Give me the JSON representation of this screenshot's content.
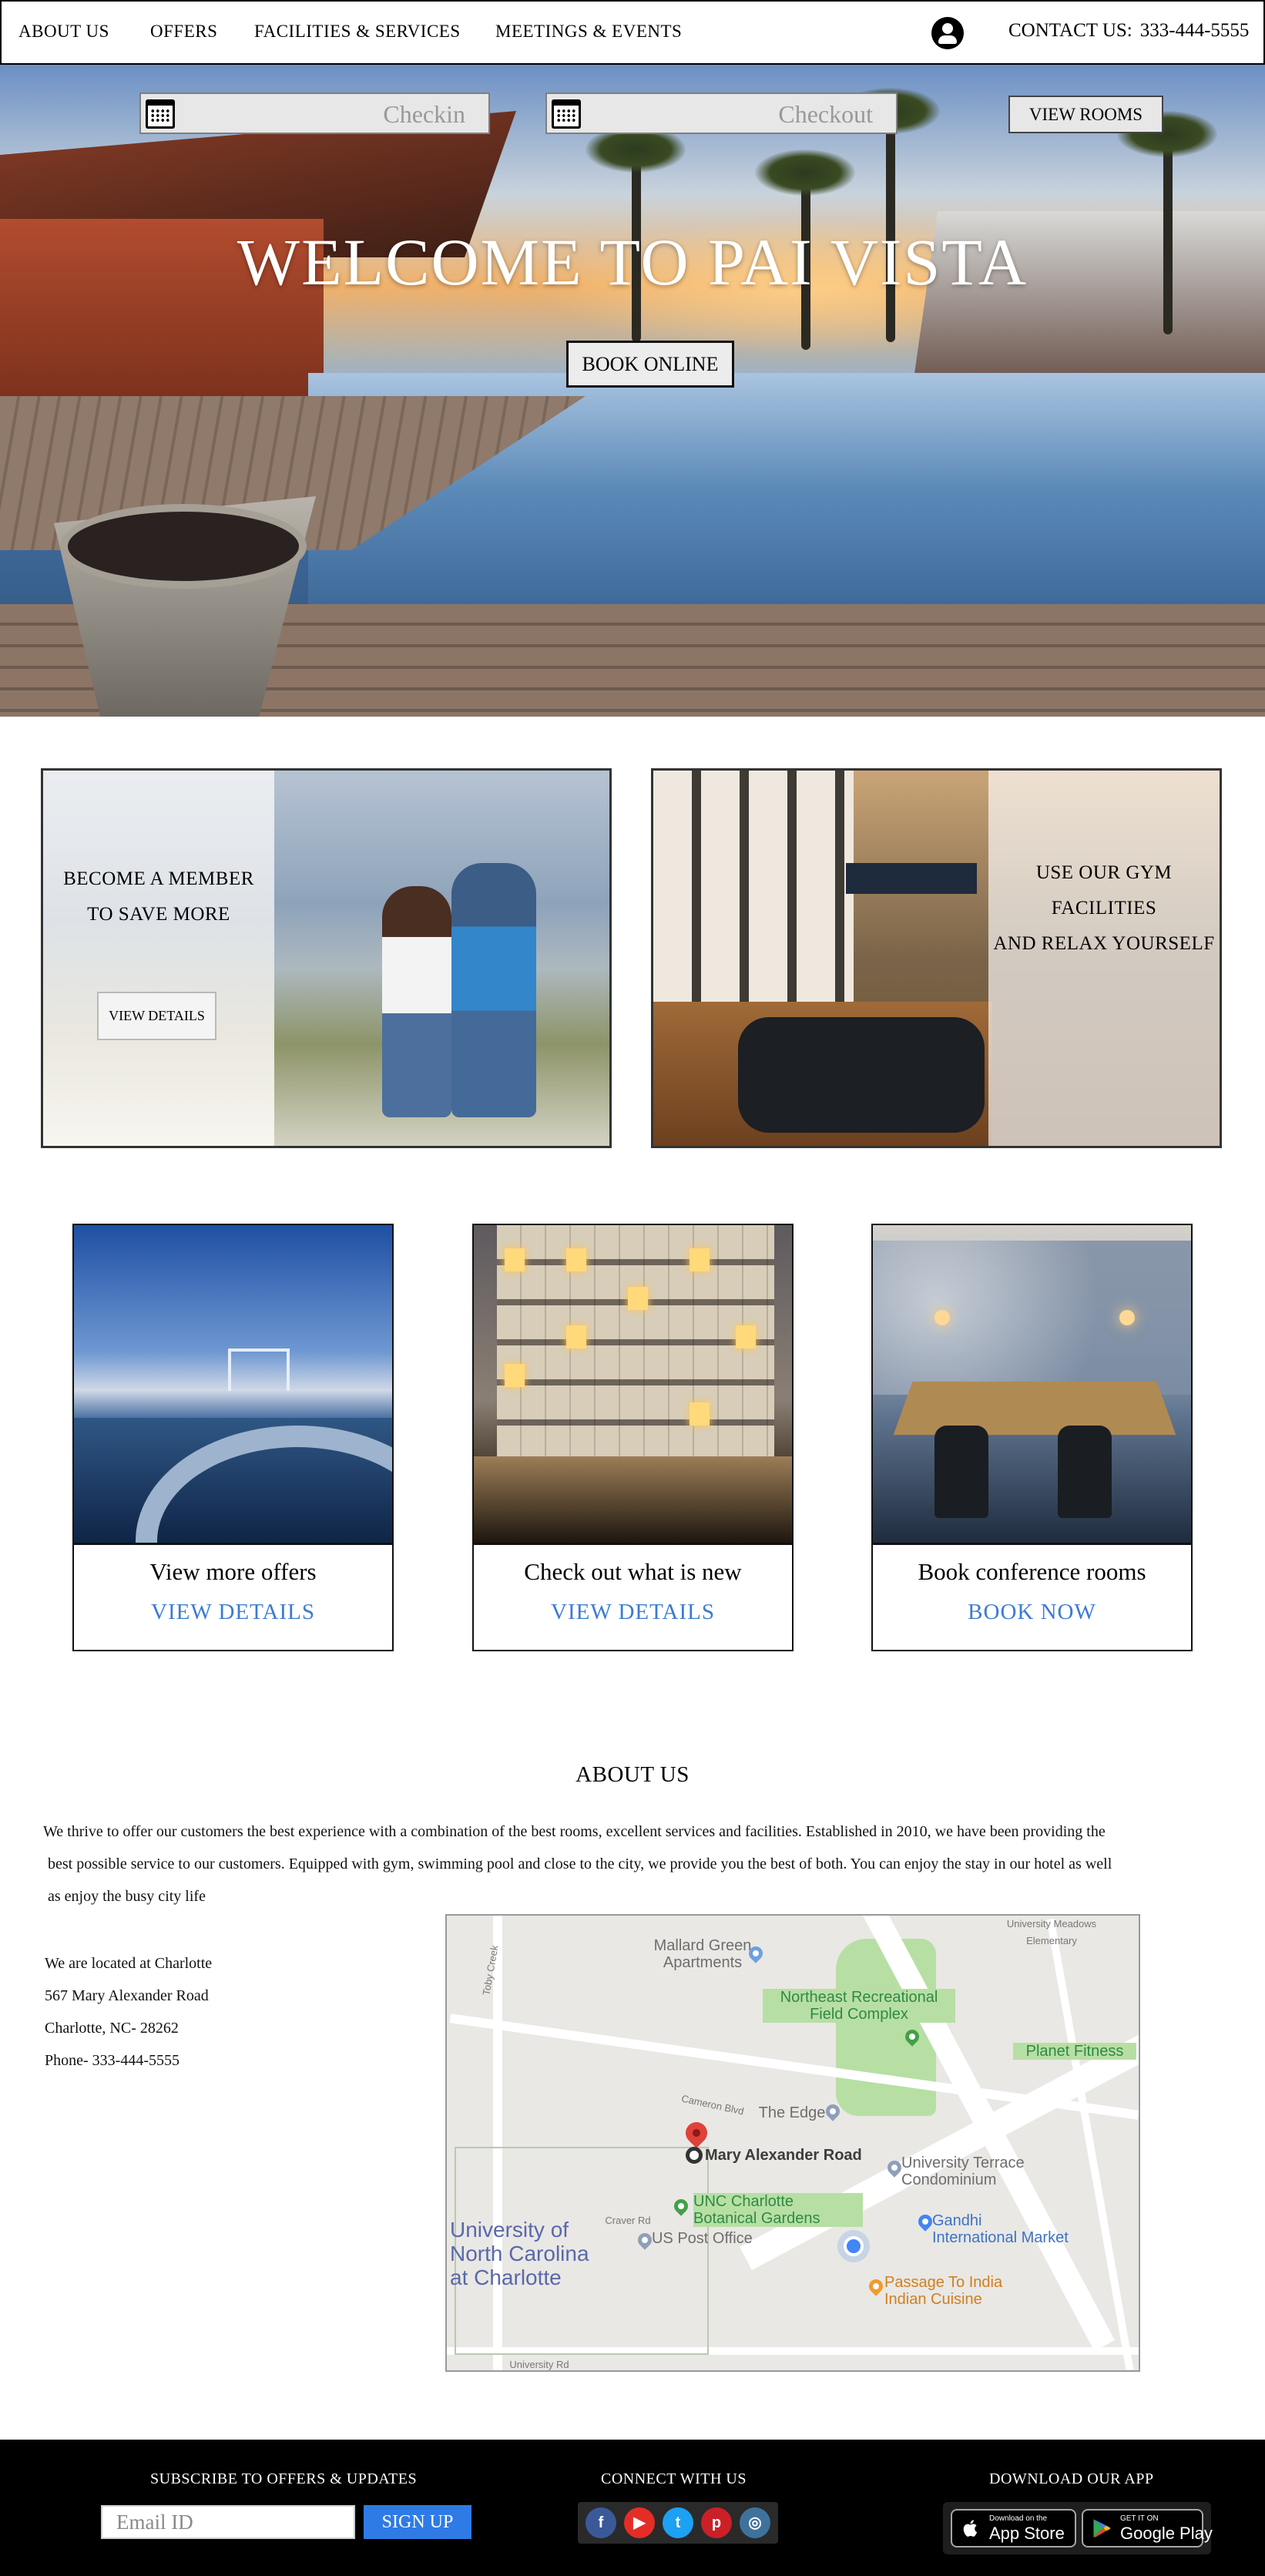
{
  "nav": {
    "items": [
      "ABOUT US",
      "OFFERS",
      "FACILITIES & SERVICES",
      "MEETINGS & EVENTS"
    ],
    "contact_label": "CONTACT US:",
    "contact_phone": "333-444-5555",
    "user_icon": "user-circle-icon"
  },
  "hero": {
    "checkin_placeholder": "Checkin",
    "checkout_placeholder": "Checkout",
    "calendar_icon": "calendar-icon",
    "view_rooms": "VIEW ROOMS",
    "title": "WELCOME TO PAI VISTA",
    "book_online": "BOOK ONLINE"
  },
  "promos": {
    "member": {
      "line1": "BECOME A MEMBER",
      "line2": "TO SAVE MORE",
      "button": "VIEW DETAILS"
    },
    "gym": {
      "line1": "USE OUR GYM",
      "line2": "FACILITIES",
      "line3": "AND RELAX YOURSELF"
    }
  },
  "features": [
    {
      "title": "View more offers",
      "link": "VIEW DETAILS"
    },
    {
      "title": "Check out what is new",
      "link": "VIEW DETAILS"
    },
    {
      "title": "Book conference rooms",
      "link": "BOOK NOW"
    }
  ],
  "about": {
    "title": "ABOUT US",
    "line1": "We thrive to offer our customers the best experience with a combination of the best rooms, excellent services and facilities. Established in 2010, we have been providing the",
    "line2": "best possible service to our customers. Equipped with gym, swimming pool and close to the city, we provide you the best of both. You can enjoy the stay in our hotel as well",
    "line3": "as enjoy the busy city life",
    "address": [
      "We are located at Charlotte",
      "567 Mary Alexander Road",
      "Charlotte, NC- 28262",
      "Phone- 333-444-5555"
    ]
  },
  "map": {
    "labels": {
      "mallard": "Mallard Green\nApartments",
      "northeast": "Northeast Recreational\nField Complex",
      "planet": "Planet Fitness",
      "edge": "The Edge",
      "mary": "Mary Alexander Road",
      "terrace": "University Terrace\nCondominium",
      "gardens": "UNC Charlotte\nBotanical Gardens",
      "gandhi": "Gandhi\nInternational Market",
      "post": "US Post Office",
      "university": "University of\nNorth Carolina\nat Charlotte",
      "passage": "Passage To India\nIndian Cuisine",
      "meadows": "University Meadows\nElementary",
      "toby": "Toby Creek",
      "univ_rd": "University Rd",
      "cameron": "Cameron Blvd",
      "craver": "Craver Rd"
    }
  },
  "footer": {
    "subscribe_title": "SUBSCRIBE TO OFFERS & UPDATES",
    "email_placeholder": "Email ID",
    "signup": "SIGN UP",
    "connect_title": "CONNECT WITH US",
    "social": [
      "facebook-icon",
      "youtube-icon",
      "twitter-icon",
      "pinterest-icon",
      "instagram-icon"
    ],
    "app_title": "DOWNLOAD OUR APP",
    "appstore_small": "Download on the",
    "appstore_big": "App Store",
    "googleplay_small": "GET IT ON",
    "googleplay_big": "Google Play"
  },
  "colors": {
    "link_blue": "#3b7bd3",
    "signup_blue": "#2e7be6",
    "facebook": "#3b5998",
    "youtube": "#e52d27",
    "twitter": "#1da1f2",
    "pinterest": "#cb2027",
    "instagram": "#3f729b"
  }
}
